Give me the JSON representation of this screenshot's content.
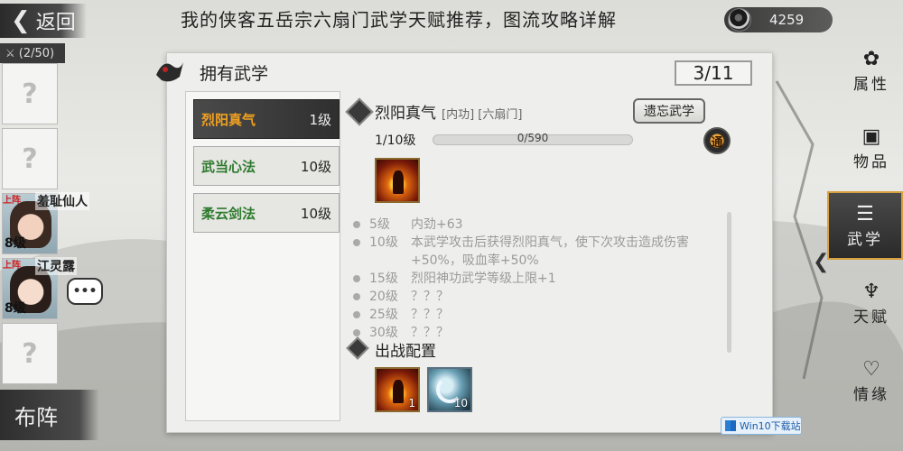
{
  "top_bar": {
    "back_label": "返回",
    "page_title": "我的侠客五岳宗六扇门武学天赋推荐，图流攻略详解",
    "currency_value": "4259",
    "coin_icon": "coin-icon"
  },
  "left_column": {
    "party_count": "(2/50)",
    "empty_slot_mark": "?",
    "heroes": [
      {
        "tag": "上阵",
        "name": "羞耻仙人",
        "level": "8级"
      },
      {
        "tag": "上阵",
        "name": "江灵露",
        "level": "8级"
      }
    ],
    "chat_icon": "chat-bubble-icon",
    "formation_label": "布阵"
  },
  "panel": {
    "title": "拥有武学",
    "count": "3/11"
  },
  "skill_list": [
    {
      "name": "烈阳真气",
      "level": "1级",
      "selected": true
    },
    {
      "name": "武当心法",
      "level": "10级",
      "selected": false
    },
    {
      "name": "柔云剑法",
      "level": "10级",
      "selected": false
    }
  ],
  "detail": {
    "name": "烈阳真气",
    "meta": "[内功] [六扇门]",
    "forget_label": "遗忘武学",
    "level": "1/10级",
    "progress_text": "0/590",
    "progress_fraction": 0,
    "badge": "通",
    "effects": [
      {
        "lv": "5级",
        "desc": "内劲+63"
      },
      {
        "lv": "10级",
        "desc": "本武学攻击后获得烈阳真气，使下次攻击造成伤害+50%，吸血率+50%"
      },
      {
        "lv": "15级",
        "desc": "烈阳神功武学等级上限+1"
      },
      {
        "lv": "20级",
        "desc": "？？？"
      },
      {
        "lv": "25级",
        "desc": "？？？"
      },
      {
        "lv": "30级",
        "desc": "？？？"
      }
    ],
    "loadout_title": "出战配置",
    "loadout": [
      {
        "icon": "fire-skill-icon",
        "count": "1"
      },
      {
        "icon": "sword-arc-icon",
        "count": "10"
      }
    ]
  },
  "right_menu": [
    {
      "label": "属性",
      "icon": "attribute-icon",
      "glyph": "✿"
    },
    {
      "label": "物品",
      "icon": "item-box-icon",
      "glyph": "▣"
    },
    {
      "label": "武学",
      "icon": "martial-book-icon",
      "glyph": "☰",
      "active": true
    },
    {
      "label": "天赋",
      "icon": "talent-icon",
      "glyph": "♆"
    },
    {
      "label": "情缘",
      "icon": "heart-icon",
      "glyph": "♡"
    }
  ],
  "watermark": "Win10下载站"
}
